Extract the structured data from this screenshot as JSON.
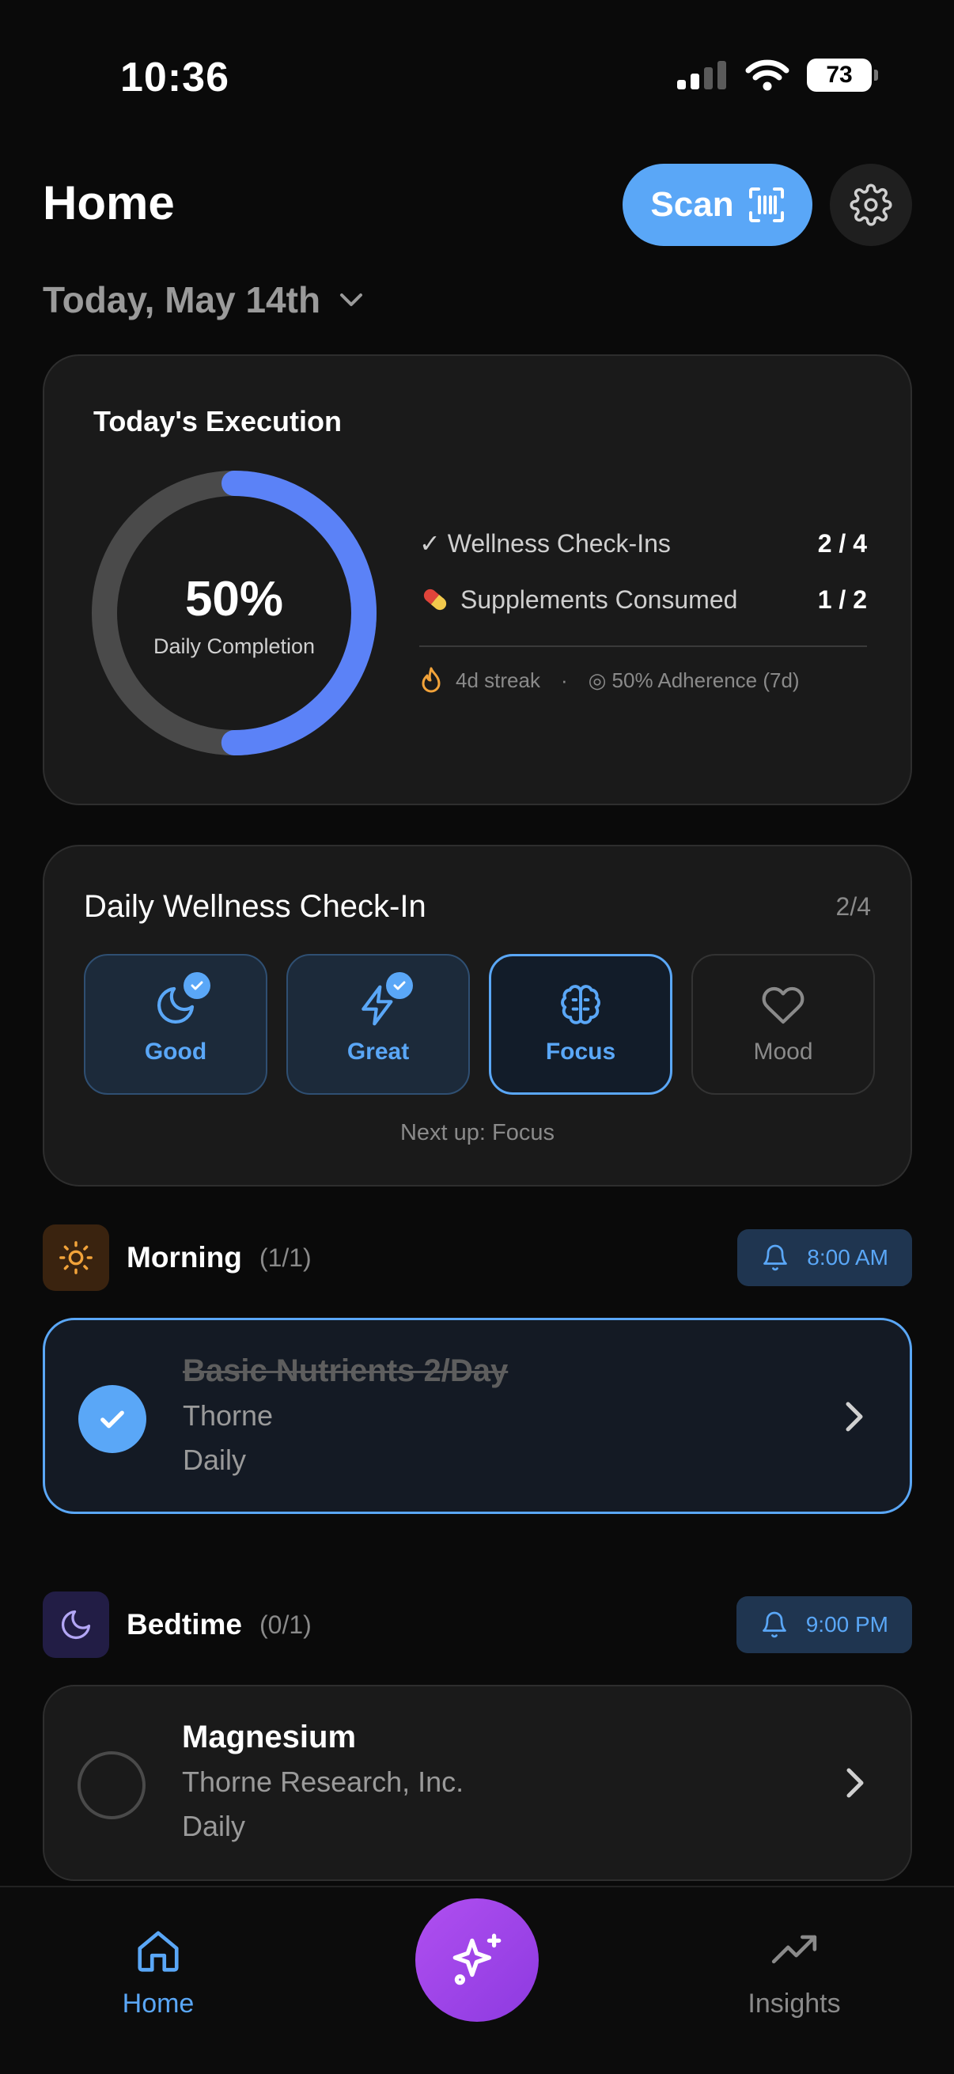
{
  "status_bar": {
    "time": "10:36",
    "battery": "73"
  },
  "header": {
    "title": "Home",
    "scan_label": "Scan",
    "date": "Today, May 14th"
  },
  "execution": {
    "title": "Today's Execution",
    "percent": "50%",
    "percent_value": 0.5,
    "percent_label": "Daily Completion",
    "wellness_label": "✓ Wellness Check-Ins",
    "wellness_value": "2 / 4",
    "supplements_label": "Supplements Consumed",
    "supplements_value": "1 / 2",
    "streak": "4d streak",
    "separator": "·",
    "adherence": "◎ 50% Adherence (7d)"
  },
  "wellness": {
    "title": "Daily Wellness Check-In",
    "count": "2/4",
    "chips": [
      {
        "label": "Good",
        "state": "done",
        "icon": "moon-icon"
      },
      {
        "label": "Great",
        "state": "done",
        "icon": "bolt-icon"
      },
      {
        "label": "Focus",
        "state": "active",
        "icon": "brain-icon"
      },
      {
        "label": "Mood",
        "state": "idle",
        "icon": "heart-icon"
      }
    ],
    "next_up": "Next up: Focus"
  },
  "sections": [
    {
      "name": "Morning",
      "count": "(1/1)",
      "reminder": "8:00 AM",
      "icon": "sun-icon",
      "items": [
        {
          "name": "Basic Nutrients 2/Day",
          "brand": "Thorne",
          "frequency": "Daily",
          "taken": true
        }
      ]
    },
    {
      "name": "Bedtime",
      "count": "(0/1)",
      "reminder": "9:00 PM",
      "icon": "moon-icon",
      "items": [
        {
          "name": "Magnesium",
          "brand": "Thorne Research, Inc.",
          "frequency": "Daily",
          "taken": false
        }
      ]
    }
  ],
  "nav": {
    "home_label": "Home",
    "insights_label": "Insights"
  },
  "colors": {
    "accent": "#5aa7f7",
    "ring": "#5b82f7",
    "fab": "#a448ec",
    "background": "#0a0a0a"
  }
}
